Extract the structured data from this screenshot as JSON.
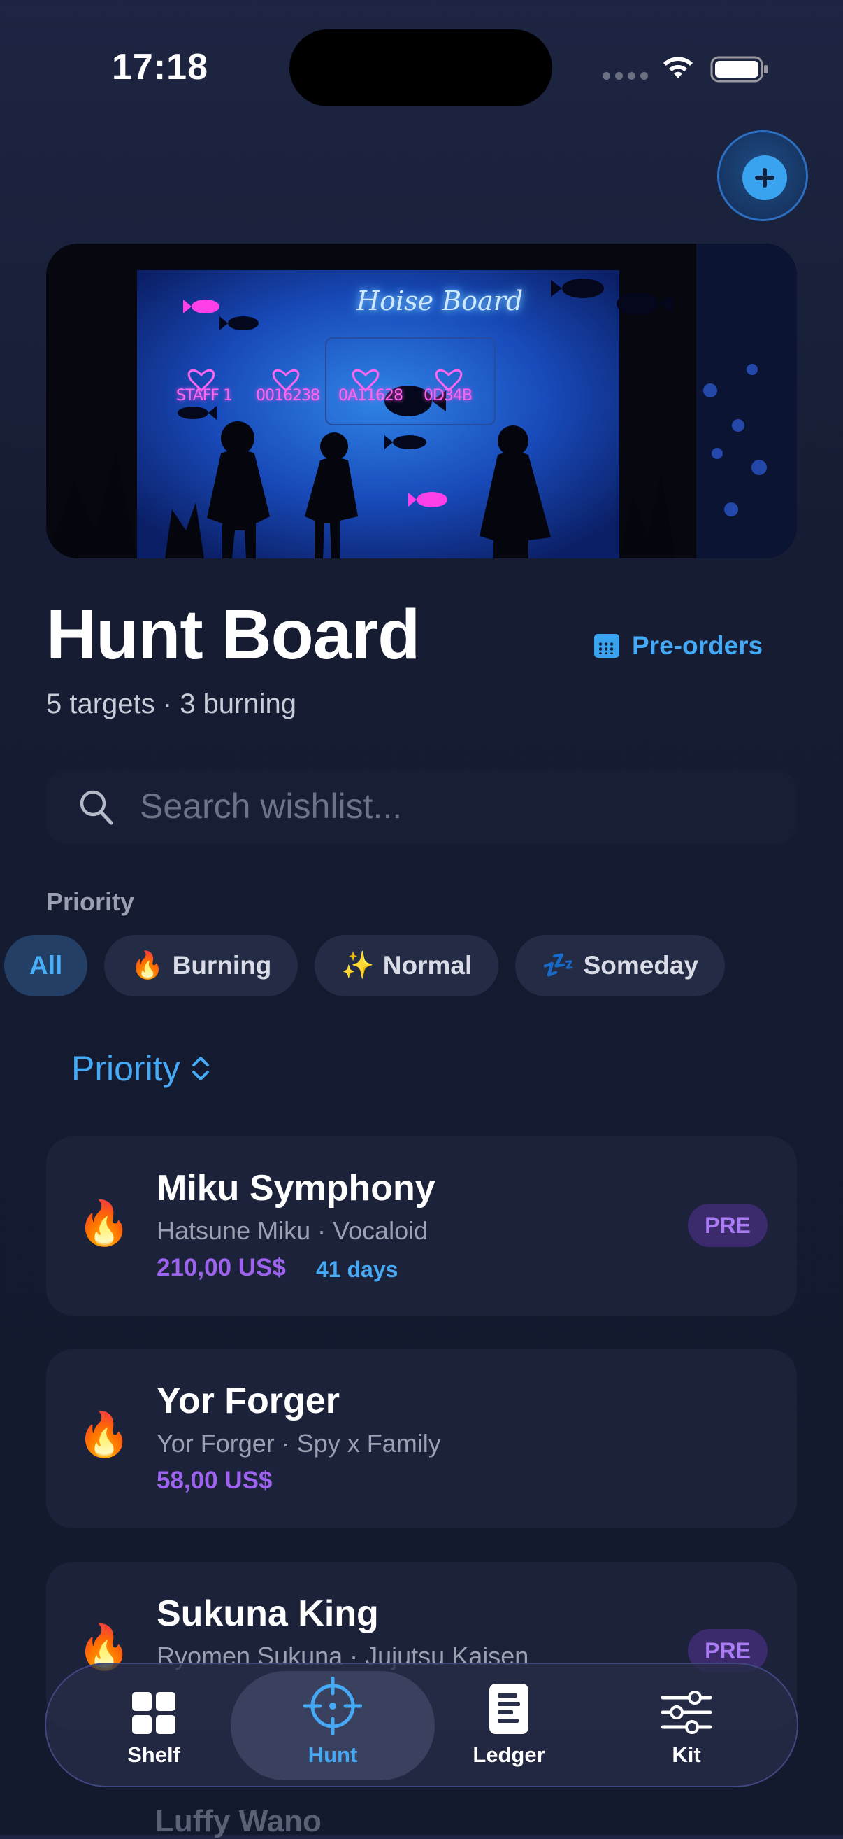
{
  "status_bar": {
    "time": "17:18"
  },
  "hero": {
    "board_title": "Hoise Board",
    "codes": [
      "STAFF 1",
      "0016238",
      "0A11628",
      "0D34B"
    ]
  },
  "header": {
    "title": "Hunt Board",
    "subtitle": "5 targets · 3 burning",
    "preorders_label": "Pre-orders"
  },
  "search": {
    "placeholder": "Search wishlist...",
    "value": ""
  },
  "filters": {
    "label": "Priority",
    "chips": [
      {
        "emoji": "",
        "label": "All",
        "active": true
      },
      {
        "emoji": "🔥",
        "label": "Burning",
        "active": false
      },
      {
        "emoji": "✨",
        "label": "Normal",
        "active": false
      },
      {
        "emoji": "💤",
        "label": "Someday",
        "active": false
      }
    ]
  },
  "sort": {
    "label": "Priority"
  },
  "items": [
    {
      "emoji": "🔥",
      "name": "Miku Symphony",
      "meta": "Hatsune Miku · Vocaloid",
      "price": "210,00 US$",
      "days": "41 days",
      "badge": "PRE"
    },
    {
      "emoji": "🔥",
      "name": "Yor Forger",
      "meta": "Yor Forger · Spy x Family",
      "price": "58,00 US$",
      "days": "",
      "badge": ""
    },
    {
      "emoji": "🔥",
      "name": "Sukuna King",
      "meta": "Ryomen Sukuna · Jujutsu Kaisen",
      "price": "",
      "days": "",
      "badge": "PRE"
    },
    {
      "emoji": "",
      "name": "Luffy Wano",
      "meta": "",
      "price": "",
      "days": "",
      "badge": ""
    }
  ],
  "tabs": [
    {
      "label": "Shelf",
      "icon": "grid-icon",
      "active": false
    },
    {
      "label": "Hunt",
      "icon": "crosshair-icon",
      "active": true
    },
    {
      "label": "Ledger",
      "icon": "document-icon",
      "active": false
    },
    {
      "label": "Kit",
      "icon": "sliders-icon",
      "active": false
    }
  ],
  "colors": {
    "accent": "#46a9f5",
    "price": "#9d63ee",
    "badge_bg": "#3b2a6c",
    "background": "#161c33"
  }
}
